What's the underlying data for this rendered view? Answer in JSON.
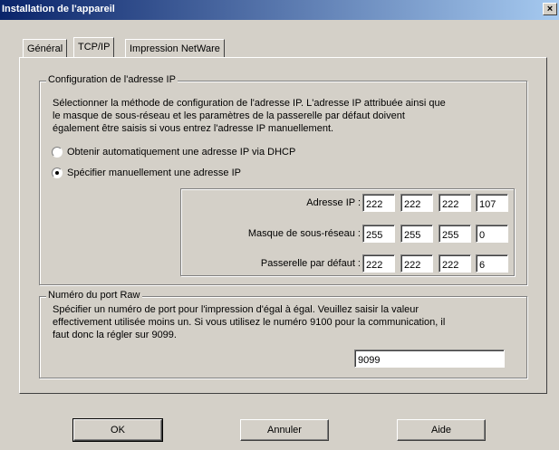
{
  "window": {
    "title": "Installation de l'appareil",
    "close_glyph": "×"
  },
  "tabs": [
    {
      "label": "Général",
      "active": false
    },
    {
      "label": "TCP/IP",
      "active": true
    },
    {
      "label": "Impression NetWare",
      "active": false
    }
  ],
  "ip_config": {
    "legend": "Configuration de l'adresse IP",
    "description_lines": [
      "Sélectionner la méthode de configuration de l'adresse IP. L'adresse IP attribuée ainsi que",
      "le masque de sous-réseau et les paramètres de la passerelle par défaut doivent",
      "également être saisis si vous entrez l'adresse IP manuellement."
    ],
    "radio_dhcp": {
      "label": "Obtenir automatiquement une adresse IP via DHCP",
      "checked": false
    },
    "radio_manual": {
      "label": "Spécifier manuellement une adresse IP",
      "checked": true
    },
    "ip_label": "Adresse IP :",
    "ip_octets": [
      "222",
      "222",
      "222",
      "107"
    ],
    "mask_label": "Masque de sous-réseau :",
    "mask_octets": [
      "255",
      "255",
      "255",
      "0"
    ],
    "gateway_label": "Passerelle par défaut :",
    "gateway_octets": [
      "222",
      "222",
      "222",
      "6"
    ]
  },
  "raw_port": {
    "legend": "Numéro du port Raw",
    "description_lines": [
      "Spécifier un numéro de port pour l'impression d'égal à égal. Veuillez saisir la valeur",
      "effectivement utilisée moins un. Si vous utilisez le numéro 9100 pour la communication, il",
      "faut donc la régler sur 9099."
    ],
    "value": "9099"
  },
  "buttons": {
    "ok": "OK",
    "cancel": "Annuler",
    "help": "Aide"
  },
  "colors": {
    "dialog_bg": "#d4d0c8",
    "title_start": "#0a246a",
    "title_end": "#a6caf0"
  }
}
